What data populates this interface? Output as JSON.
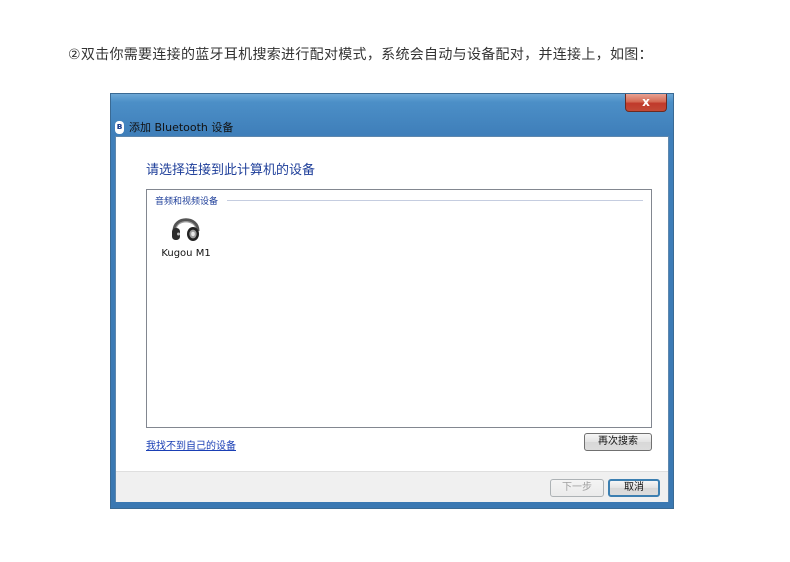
{
  "caption": "②双击你需要连接的蓝牙耳机搜索进行配对模式，系统会自动与设备配对，并连接上，如图：",
  "window": {
    "title": "添加 Bluetooth 设备",
    "close_label": "x"
  },
  "main": {
    "heading": "请选择连接到此计算机的设备",
    "group_label": "音频和视频设备",
    "devices": [
      {
        "name": "Kugou M1",
        "icon": "headphone-icon"
      }
    ],
    "help_link": "我找不到自己的设备",
    "search_again_label": "再次搜索"
  },
  "footer": {
    "next_label": "下一步",
    "cancel_label": "取消"
  },
  "colors": {
    "title_bar": "#3f7fba",
    "heading_text": "#1f3f9a",
    "link": "#1a3fb5",
    "close_button": "#c0392b"
  }
}
